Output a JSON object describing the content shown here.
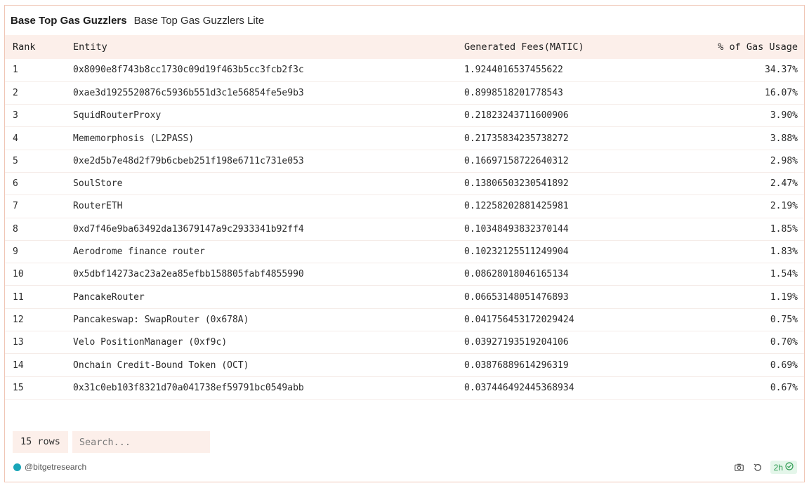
{
  "header": {
    "title": "Base Top Gas Guzzlers",
    "subtitle": "Base Top Gas Guzzlers Lite"
  },
  "table": {
    "columns": [
      "Rank",
      "Entity",
      "Generated Fees(MATIC)",
      "% of Gas Usage"
    ],
    "rows": [
      [
        "1",
        "0x8090e8f743b8cc1730c09d19f463b5cc3fcb2f3c",
        "1.9244016537455622",
        "34.37%"
      ],
      [
        "2",
        "0xae3d1925520876c5936b551d3c1e56854fe5e9b3",
        "0.8998518201778543",
        "16.07%"
      ],
      [
        "3",
        "SquidRouterProxy",
        "0.21823243711600906",
        "3.90%"
      ],
      [
        "4",
        "Mememorphosis (L2PASS)",
        "0.21735834235738272",
        "3.88%"
      ],
      [
        "5",
        "0xe2d5b7e48d2f79b6cbeb251f198e6711c731e053",
        "0.16697158722640312",
        "2.98%"
      ],
      [
        "6",
        "SoulStore",
        "0.13806503230541892",
        "2.47%"
      ],
      [
        "7",
        "RouterETH",
        "0.12258202881425981",
        "2.19%"
      ],
      [
        "8",
        "0xd7f46e9ba63492da13679147a9c2933341b92ff4",
        "0.10348493832370144",
        "1.85%"
      ],
      [
        "9",
        "Aerodrome finance router",
        "0.10232125511249904",
        "1.83%"
      ],
      [
        "10",
        "0x5dbf14273ac23a2ea85efbb158805fabf4855990",
        "0.08628018046165134",
        "1.54%"
      ],
      [
        "11",
        "PancakeRouter",
        "0.06653148051476893",
        "1.19%"
      ],
      [
        "12",
        "Pancakeswap: SwapRouter (0x678A)",
        "0.041756453172029424",
        "0.75%"
      ],
      [
        "13",
        "Velo PositionManager (0xf9c)",
        "0.03927193519204106",
        "0.70%"
      ],
      [
        "14",
        "Onchain Credit-Bound Token (OCT)",
        "0.03876889614296319",
        "0.69%"
      ],
      [
        "15",
        "0x31c0eb103f8321d70a041738ef59791bc0549abb",
        "0.037446492445368934",
        "0.67%"
      ]
    ]
  },
  "footer": {
    "rows_label": "15 rows",
    "search_placeholder": "Search...",
    "author": "@bitgetresearch",
    "age": "2h"
  },
  "icons": {
    "camera": "camera-icon",
    "refresh": "refresh-icon",
    "check": "check-circle-icon"
  },
  "colors": {
    "accent_border": "#f0c6b6",
    "header_bg": "#fcefea",
    "success": "#2e9b52"
  }
}
